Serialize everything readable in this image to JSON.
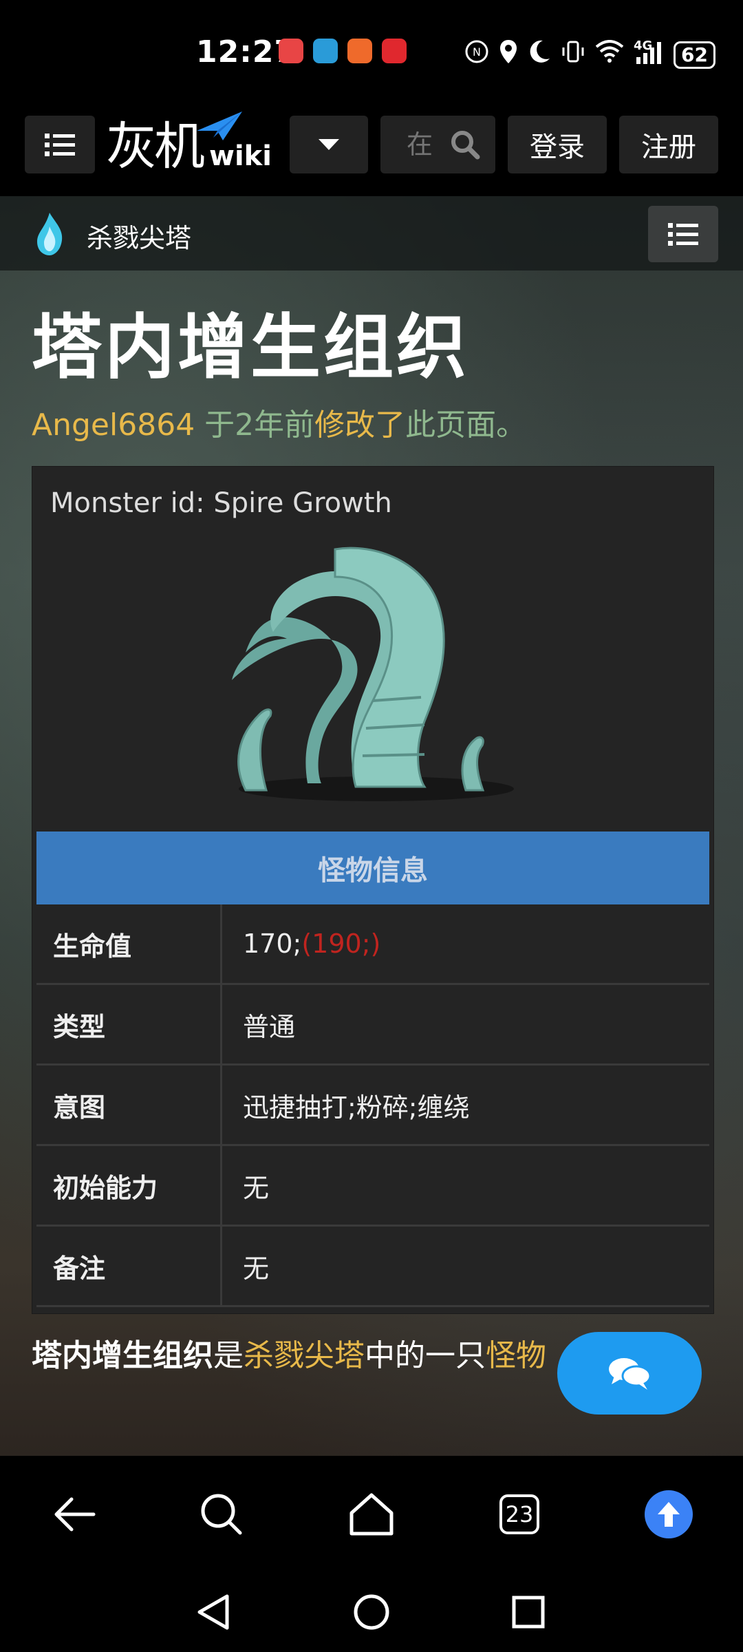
{
  "status_bar": {
    "time": "12:27",
    "battery": "62",
    "network": "4G",
    "icons": [
      "huawei-app-icon",
      "browser-app-icon",
      "fitness-app-icon",
      "video-app-icon",
      "nfc-icon",
      "location-icon",
      "moon-icon",
      "vibrate-icon",
      "wifi-icon",
      "signal-icon"
    ]
  },
  "topnav": {
    "logo_text": "灰机",
    "logo_wiki": "wiki",
    "search_placeholder": "在",
    "login": "登录",
    "register": "注册"
  },
  "subnav": {
    "title": "杀戮尖塔"
  },
  "page": {
    "title": "塔内增生组织",
    "edit_user": "Angel6864",
    "edit_mid": " 于2年前",
    "edit_link": "修改了",
    "edit_end": "此页面。"
  },
  "infobox": {
    "monster_id": "Monster id: Spire Growth",
    "header": "怪物信息",
    "rows": [
      {
        "label": "生命值",
        "value": "170;",
        "value_extra": "(190;)"
      },
      {
        "label": "类型",
        "value": "普通"
      },
      {
        "label": "意图",
        "value": "迅捷抽打;粉碎;缠绕"
      },
      {
        "label": "初始能力",
        "value": "无"
      },
      {
        "label": "备注",
        "value": "无"
      }
    ]
  },
  "paragraph": {
    "bold": "塔内增生组织",
    "t1": "是",
    "link1": "杀戮尖塔",
    "t2": "中的一只",
    "link2": "怪物"
  },
  "bottom_bar": {
    "tabs_count": "23"
  },
  "colors": {
    "accent_blue": "#3a7bbf",
    "link_gold": "#e8b94a",
    "fab_blue": "#1e9bf0",
    "hp_red": "#c0241f"
  }
}
